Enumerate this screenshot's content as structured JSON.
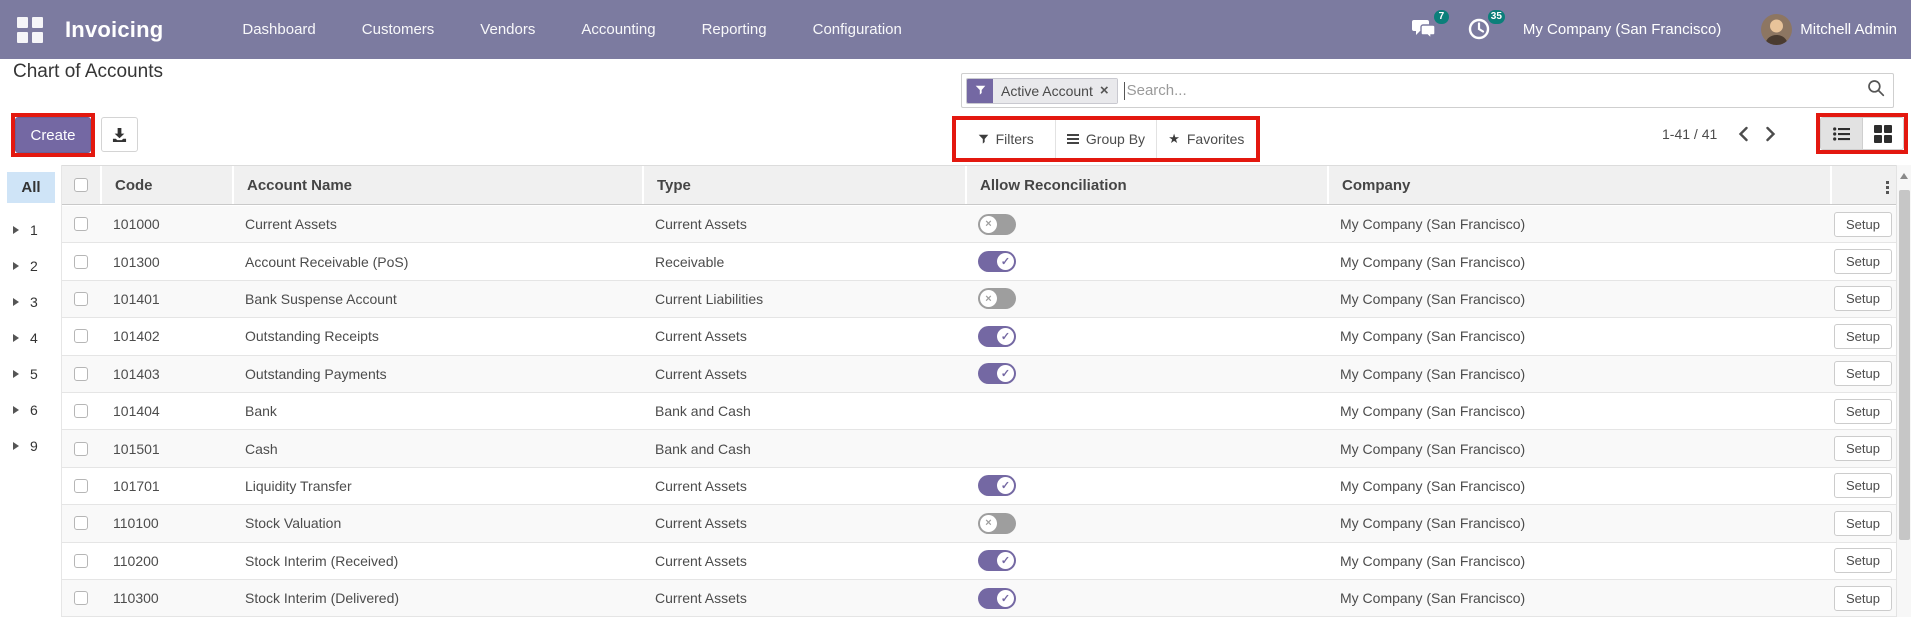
{
  "nav": {
    "app_name": "Invoicing",
    "menus": [
      "Dashboard",
      "Customers",
      "Vendors",
      "Accounting",
      "Reporting",
      "Configuration"
    ],
    "messages_count": "7",
    "activities_count": "35",
    "company": "My Company (San Francisco)",
    "user": "Mitchell Admin"
  },
  "page": {
    "title": "Chart of Accounts",
    "create_label": "Create",
    "filters_label": "Filters",
    "groupby_label": "Group By",
    "favorites_label": "Favorites",
    "pager_text": "1-41 / 41"
  },
  "search": {
    "facet_label": "Active Account",
    "facet_remove": "×",
    "placeholder": "Search..."
  },
  "sidebar": {
    "all_label": "All",
    "groups": [
      "1",
      "2",
      "3",
      "4",
      "5",
      "6",
      "9"
    ]
  },
  "table": {
    "columns": [
      "Code",
      "Account Name",
      "Type",
      "Allow Reconciliation",
      "Company"
    ],
    "setup_label": "Setup",
    "rows": [
      {
        "code": "101000",
        "name": "Current Assets",
        "type": "Current Assets",
        "reconcile": "off",
        "company": "My Company (San Francisco)"
      },
      {
        "code": "101300",
        "name": "Account Receivable (PoS)",
        "type": "Receivable",
        "reconcile": "on",
        "company": "My Company (San Francisco)"
      },
      {
        "code": "101401",
        "name": "Bank Suspense Account",
        "type": "Current Liabilities",
        "reconcile": "off",
        "company": "My Company (San Francisco)"
      },
      {
        "code": "101402",
        "name": "Outstanding Receipts",
        "type": "Current Assets",
        "reconcile": "on",
        "company": "My Company (San Francisco)"
      },
      {
        "code": "101403",
        "name": "Outstanding Payments",
        "type": "Current Assets",
        "reconcile": "on",
        "company": "My Company (San Francisco)"
      },
      {
        "code": "101404",
        "name": "Bank",
        "type": "Bank and Cash",
        "reconcile": "none",
        "company": "My Company (San Francisco)"
      },
      {
        "code": "101501",
        "name": "Cash",
        "type": "Bank and Cash",
        "reconcile": "none",
        "company": "My Company (San Francisco)"
      },
      {
        "code": "101701",
        "name": "Liquidity Transfer",
        "type": "Current Assets",
        "reconcile": "on",
        "company": "My Company (San Francisco)"
      },
      {
        "code": "110100",
        "name": "Stock Valuation",
        "type": "Current Assets",
        "reconcile": "off",
        "company": "My Company (San Francisco)"
      },
      {
        "code": "110200",
        "name": "Stock Interim (Received)",
        "type": "Current Assets",
        "reconcile": "on",
        "company": "My Company (San Francisco)"
      },
      {
        "code": "110300",
        "name": "Stock Interim (Delivered)",
        "type": "Current Assets",
        "reconcile": "on",
        "company": "My Company (San Francisco)"
      }
    ]
  },
  "colors": {
    "navbar": "#7c7ba0",
    "accent": "#7468a3",
    "badge": "#0b7f7a",
    "annotation": "#e3180f",
    "all-bg": "#cfe4f7"
  }
}
